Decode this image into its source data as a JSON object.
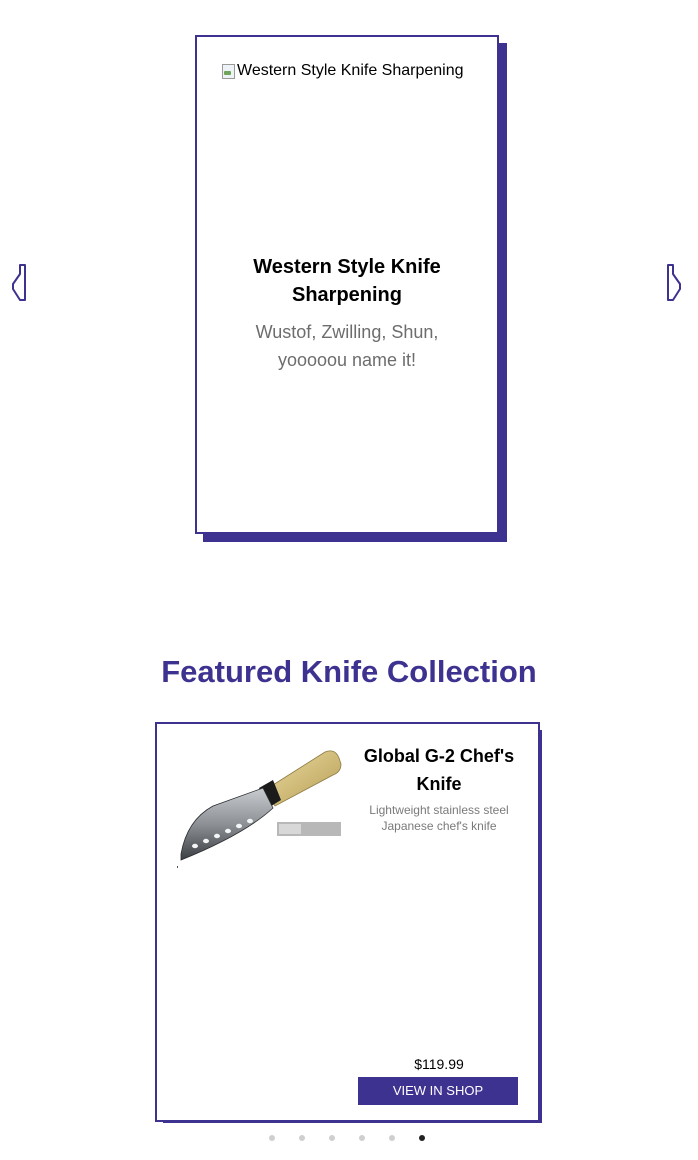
{
  "service_carousel": {
    "card": {
      "image_alt": "Western Style Knife Sharpening",
      "title": "Western Style Knife Sharpening",
      "description": "Wustof, Zwilling, Shun, yooooou name it!"
    },
    "prev_icon": "left-arrow-icon",
    "next_icon": "right-arrow-icon"
  },
  "featured": {
    "title": "Featured Knife Collection",
    "product": {
      "name": "Global G-2 Chef's Knife",
      "description": "Lightweight stainless steel Japanese chef's knife",
      "price": "$119.99",
      "button_label": "View in Shop"
    },
    "pagination": {
      "total": 6,
      "active_index": 5
    }
  },
  "colors": {
    "accent": "#3e3291",
    "muted_text": "#6d6d6d",
    "dot_inactive": "#cfcfcf",
    "dot_active": "#222222"
  }
}
